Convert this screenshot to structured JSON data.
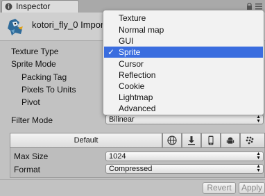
{
  "window": {
    "tab_title": "Inspector",
    "tab_icon": "info-icon",
    "lock_icon": "lock-icon",
    "menu_icon": "panel-menu-icon"
  },
  "asset": {
    "title": "kotori_fly_0 Impor",
    "thumbnail": "sprite-thumbnail"
  },
  "properties": {
    "texture_type_label": "Texture Type",
    "sprite_mode_label": "Sprite Mode",
    "packing_tag_label": "Packing Tag",
    "pixels_to_units_label": "Pixels To Units",
    "pivot_label": "Pivot",
    "filter_mode_label": "Filter Mode",
    "filter_mode_value": "Bilinear"
  },
  "texture_type_menu": {
    "options": [
      "Texture",
      "Normal map",
      "GUI",
      "Sprite",
      "Cursor",
      "Reflection",
      "Cookie",
      "Lightmap",
      "Advanced"
    ],
    "selected": "Sprite",
    "check_mark": "✓",
    "selection_color": "#3a6ddf"
  },
  "platform": {
    "default_tab": "Default",
    "icons": [
      "web-globe-icon",
      "standalone-download-icon",
      "iphone-icon",
      "android-icon",
      "blackberry-icon"
    ],
    "max_size_label": "Max Size",
    "max_size_value": "1024",
    "format_label": "Format",
    "format_value": "Compressed"
  },
  "buttons": {
    "revert": "Revert",
    "apply": "Apply"
  }
}
